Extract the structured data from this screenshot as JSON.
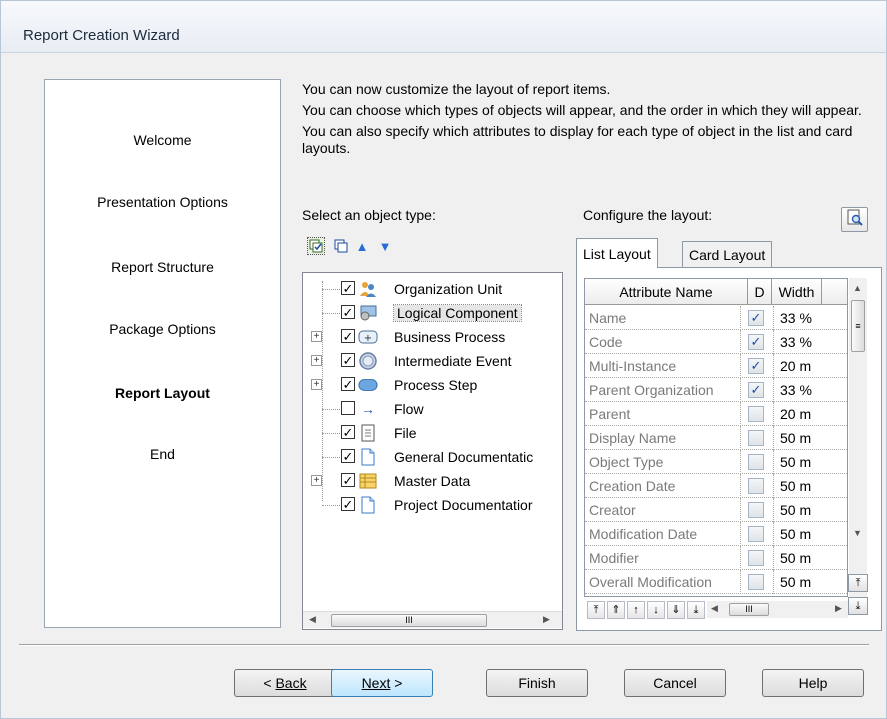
{
  "window": {
    "title": "Report Creation Wizard"
  },
  "steps": [
    {
      "label": "Welcome",
      "active": false
    },
    {
      "label": "Presentation Options",
      "active": false
    },
    {
      "label": "Report Structure",
      "active": false
    },
    {
      "label": "Package Options",
      "active": false
    },
    {
      "label": "Report Layout",
      "active": true
    },
    {
      "label": "End",
      "active": false
    }
  ],
  "intro": {
    "line1": "You can now customize the layout of report items.",
    "line2": "You can choose which types of objects will appear, and the order in which they will appear.",
    "line3": "You can also specify which attributes to display for each type of object in the list and card layouts."
  },
  "object_panel": {
    "label": "Select an object type:",
    "toolbar_icons": [
      "select-all-icon",
      "deselect-all-icon",
      "move-up-icon",
      "move-down-icon"
    ],
    "items": [
      {
        "label": "Organization Unit",
        "checked": true,
        "expandable": false,
        "icon": "organization-unit-icon"
      },
      {
        "label": "Logical Component",
        "checked": true,
        "expandable": false,
        "icon": "logical-component-icon",
        "selected": true
      },
      {
        "label": "Business Process",
        "checked": true,
        "expandable": true,
        "icon": "business-process-icon"
      },
      {
        "label": "Intermediate Event",
        "checked": true,
        "expandable": true,
        "icon": "intermediate-event-icon"
      },
      {
        "label": "Process Step",
        "checked": true,
        "expandable": true,
        "icon": "process-step-icon"
      },
      {
        "label": "Flow",
        "checked": false,
        "expandable": false,
        "icon": "flow-arrow-icon"
      },
      {
        "label": "File",
        "checked": true,
        "expandable": false,
        "icon": "file-icon"
      },
      {
        "label": "General Documentatic",
        "checked": true,
        "expandable": false,
        "icon": "document-icon"
      },
      {
        "label": "Master Data",
        "checked": true,
        "expandable": true,
        "icon": "master-data-icon"
      },
      {
        "label": "Project Documentatior",
        "checked": true,
        "expandable": false,
        "icon": "document-icon"
      }
    ],
    "hscroll_thumb": "III"
  },
  "layout_panel": {
    "label": "Configure the layout:",
    "tabs": [
      {
        "label": "List Layout",
        "active": true
      },
      {
        "label": "Card Layout",
        "active": false
      }
    ],
    "columns": [
      "Attribute Name",
      "D",
      "Width"
    ],
    "rows": [
      {
        "name": "Name",
        "d": true,
        "width": "33 %"
      },
      {
        "name": "Code",
        "d": true,
        "width": "33 %"
      },
      {
        "name": "Multi-Instance",
        "d": true,
        "width": "20 m"
      },
      {
        "name": "Parent Organization",
        "d": true,
        "width": "33 %"
      },
      {
        "name": "Parent",
        "d": false,
        "width": "20 m"
      },
      {
        "name": "Display Name",
        "d": false,
        "width": "50 m"
      },
      {
        "name": "Object Type",
        "d": false,
        "width": "50 m"
      },
      {
        "name": "Creation Date",
        "d": false,
        "width": "50 m"
      },
      {
        "name": "Creator",
        "d": false,
        "width": "50 m"
      },
      {
        "name": "Modification Date",
        "d": false,
        "width": "50 m"
      },
      {
        "name": "Modifier",
        "d": false,
        "width": "50 m"
      },
      {
        "name": "Overall Modification",
        "d": false,
        "width": "50 m"
      }
    ],
    "check_glyph": "✓",
    "hscroll_thumb": "III",
    "vscroll_thumb": "≡"
  },
  "buttons": {
    "back": {
      "label": "Back",
      "prefix": "< "
    },
    "next": {
      "label": "Next",
      "suffix": " >"
    },
    "finish": {
      "label": "Finish"
    },
    "cancel": {
      "label": "Cancel"
    },
    "help": {
      "label": "Help"
    }
  }
}
